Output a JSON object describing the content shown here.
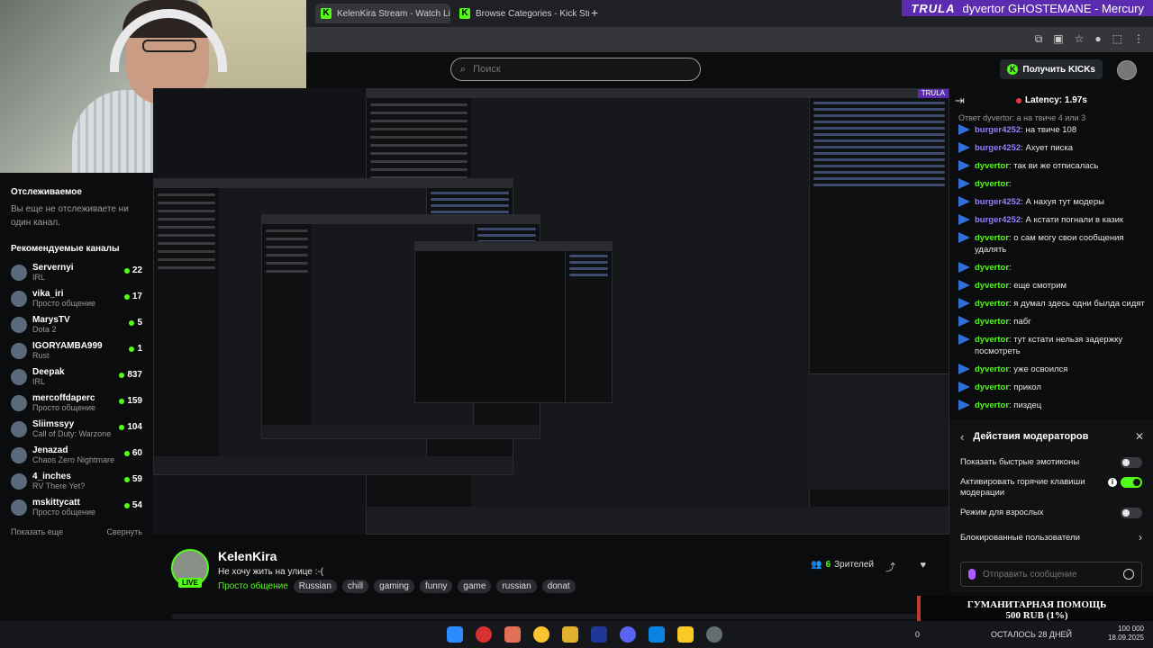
{
  "browser": {
    "tabs": [
      {
        "label": "KelenKira Stream - Watch Live o"
      },
      {
        "label": "Browse Categories - Kick Stream"
      }
    ]
  },
  "overlay": {
    "trula": "TRULA",
    "now_playing": "dyvertor GHOSTEMANE - Mercury"
  },
  "header": {
    "search_placeholder": "Поиск",
    "get_kicks": "Получить KICKs"
  },
  "sidebar": {
    "following_title": "Отслеживаемое",
    "following_note": "Вы еще не отслеживаете ни один канал.",
    "recommended_title": "Рекомендуемые каналы",
    "channels": [
      {
        "name": "Servernyi",
        "category": "IRL",
        "viewers": "22"
      },
      {
        "name": "vika_iri",
        "category": "Просто общение",
        "viewers": "17"
      },
      {
        "name": "MarysTV",
        "category": "Dota 2",
        "viewers": "5"
      },
      {
        "name": "IGORYAMBA999",
        "category": "Rust",
        "viewers": "1"
      },
      {
        "name": "Deepak",
        "category": "IRL",
        "viewers": "837"
      },
      {
        "name": "mercoffdaperc",
        "category": "Просто общение",
        "viewers": "159"
      },
      {
        "name": "Sliimssyy",
        "category": "Call of Duty: Warzone",
        "viewers": "104"
      },
      {
        "name": "Jenazad",
        "category": "Chaos Zero Nightmare",
        "viewers": "60"
      },
      {
        "name": "4_inches",
        "category": "RV There Yet?",
        "viewers": "59"
      },
      {
        "name": "mskittycatt",
        "category": "Просто общение",
        "viewers": "54"
      }
    ],
    "show_more": "Показать еще",
    "collapse": "Свернуть"
  },
  "stream": {
    "channel": "KelenKira",
    "live": "LIVE",
    "title": "Не хочу жить на улице :-(",
    "category": "Просто общение",
    "tags": [
      "Russian",
      "chill",
      "gaming",
      "funny",
      "game",
      "russian",
      "donat"
    ],
    "viewers_count": "6",
    "viewers_label": "Зрителей"
  },
  "chat": {
    "latency": "Latency: 1.97s",
    "reply_note": "Ответ dyvertor: а на твиче 4 или 3",
    "messages": [
      {
        "user": "burger4252",
        "text": "на твиче 108",
        "kind": "burger"
      },
      {
        "user": "burger4252",
        "text": "Ахует писка",
        "kind": "burger"
      },
      {
        "user": "dyvertor",
        "text": "так ви же отписалась",
        "kind": "dyv"
      },
      {
        "user": "dyvertor",
        "text": "",
        "kind": "dyv"
      },
      {
        "user": "burger4252",
        "text": "А нахуя тут модеры",
        "kind": "burger"
      },
      {
        "user": "burger4252",
        "text": "А кстати погнали в казик",
        "kind": "burger"
      },
      {
        "user": "dyvertor",
        "text": "о сам могу свои сообщения удалять",
        "kind": "dyv"
      },
      {
        "user": "dyvertor",
        "text": "",
        "kind": "dyv"
      },
      {
        "user": "dyvertor",
        "text": "еще смотрим",
        "kind": "dyv"
      },
      {
        "user": "dyvertor",
        "text": "я думал здесь одни былда сидят",
        "kind": "dyv"
      },
      {
        "user": "dyvertor",
        "text": "пабг",
        "kind": "dyv"
      },
      {
        "user": "dyvertor",
        "text": "тут кстати нельзя задержку посмотреть",
        "kind": "dyv"
      },
      {
        "user": "dyvertor",
        "text": "уже освоился",
        "kind": "dyv"
      },
      {
        "user": "dyvertor",
        "text": "прикол",
        "kind": "dyv"
      },
      {
        "user": "dyvertor",
        "text": "пиздец",
        "kind": "dyv"
      }
    ]
  },
  "mod_panel": {
    "title": "Действия модераторов",
    "rows": [
      {
        "label": "Показать быстрые эмотиконы",
        "state": "off"
      },
      {
        "label": "Активировать горячие клавиши модерации",
        "state": "on"
      },
      {
        "label": "Режим для взрослых",
        "state": "off"
      },
      {
        "label": "Блокированные пользователи",
        "state": "link"
      }
    ],
    "send_placeholder": "Отправить сообщение"
  },
  "donation": {
    "title": "ГУМАНИТАРНАЯ ПОМОЩЬ",
    "amount": "500 RUB (1%)",
    "left_value": "0",
    "days_left": "ОСТАЛОСЬ 28 ДНЕЙ",
    "goal": "100 000"
  },
  "taskbar": {
    "date": "18.09.2025"
  },
  "colors": {
    "accent": "#53fc18",
    "trula": "#5b2bb0",
    "burger_name": "#9b7dff"
  }
}
